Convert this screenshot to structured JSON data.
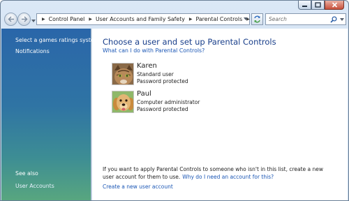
{
  "window": {
    "controls": {
      "minimize_icon": "minimize-icon",
      "maximize_icon": "maximize-icon",
      "close_icon": "close-icon"
    }
  },
  "navigation": {
    "back_icon": "back-arrow-icon",
    "forward_icon": "forward-arrow-icon",
    "breadcrumbs": [
      "Control Panel",
      "User Accounts and Family Safety",
      "Parental Controls"
    ],
    "search_placeholder": "Search"
  },
  "sidebar": {
    "tasks": [
      "Select a games ratings system",
      "Notifications"
    ],
    "see_also_title": "See also",
    "see_also_links": [
      "User Accounts"
    ]
  },
  "main": {
    "title": "Choose a user and set up Parental Controls",
    "help_link": "What can I do with Parental Controls?",
    "users": [
      {
        "name": "Karen",
        "type": "Standard user",
        "status": "Password protected",
        "avatar": "cat-avatar"
      },
      {
        "name": "Paul",
        "type": "Computer administrator",
        "status": "Password protected",
        "avatar": "dog-avatar"
      }
    ],
    "info_text": "If you want to apply Parental Controls to someone who isn't in this list, create a new user account for them to use.",
    "why_link": "Why do I need an account for this?",
    "create_link": "Create a new user account"
  },
  "colors": {
    "title_blue": "#183e8a",
    "link_blue": "#1a56b5",
    "sidebar_top": "#2a66a9",
    "sidebar_bottom": "#58a67f"
  }
}
